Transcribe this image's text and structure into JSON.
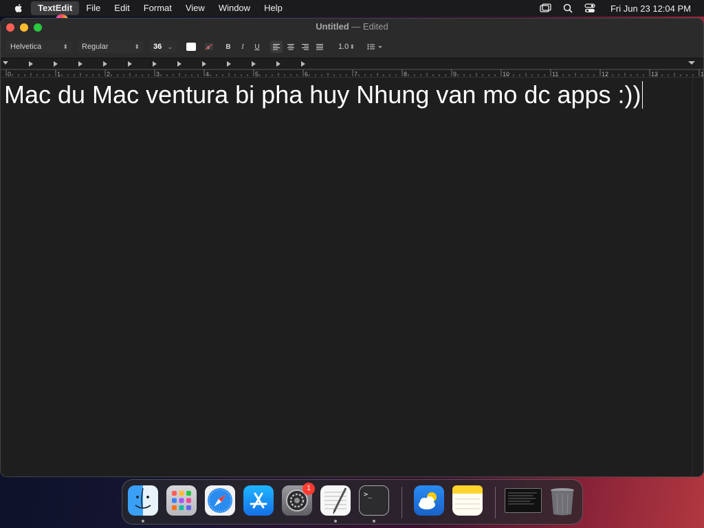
{
  "menubar": {
    "app_name": "TextEdit",
    "items": [
      "File",
      "Edit",
      "Format",
      "View",
      "Window",
      "Help"
    ],
    "clock": "Fri Jun 23  12:04 PM",
    "icons": [
      "screen-mirroring-icon",
      "spotlight-search-icon",
      "control-center-icon"
    ]
  },
  "window": {
    "title": "Untitled",
    "title_suffix": "— Edited"
  },
  "toolbar": {
    "font_family": "Helvetica",
    "font_style": "Regular",
    "font_size": "36",
    "bold": "B",
    "italic": "I",
    "underline": "U",
    "line_spacing": "1.0"
  },
  "ruler": {
    "labels": [
      "0",
      "1",
      "2",
      "3",
      "4",
      "5",
      "6",
      "7",
      "8",
      "9",
      "10",
      "11",
      "12",
      "13",
      "14"
    ]
  },
  "document": {
    "text": "Mac du Mac ventura bi pha huy Nhung van mo dc apps :))"
  },
  "dock": {
    "apps": [
      "finder",
      "launchpad",
      "safari",
      "app-store",
      "system-settings",
      "textedit",
      "terminal",
      "weather",
      "notes",
      "minimized-window",
      "trash"
    ],
    "settings_badge": "1"
  },
  "colors": {
    "menubar_bg": "#1b1b1d",
    "window_bg": "#1e1e1e",
    "titlebar_bg": "#2b2b2b",
    "text": "#ffffff",
    "close": "#ff5f57",
    "minimize": "#febc2e",
    "maximize": "#28c840"
  }
}
